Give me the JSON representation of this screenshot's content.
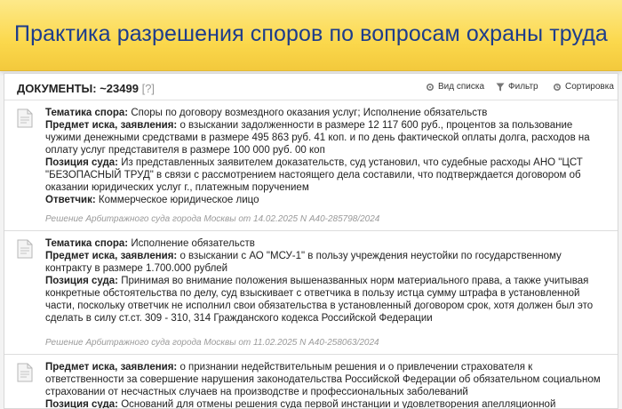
{
  "banner": {
    "title": "Практика разрешения споров по вопросам охраны труда"
  },
  "toolbar": {
    "count_label": "ДОКУМЕНТЫ: ~23499",
    "help_label": "[?]",
    "view_list_label": "Вид списка",
    "filter_label": "Фильтр",
    "sort_label": "Сортировка"
  },
  "labels": {
    "topic": "Тематика спора:",
    "claim": "Предмет иска, заявления:",
    "court": "Позиция суда:",
    "defendant": "Ответчик:"
  },
  "documents": [
    {
      "topic": "Споры по договору возмездного оказания услуг; Исполнение обязательств",
      "claim": "о взыскании задолженности в размере 12 117 600 руб., процентов за пользование чужими денежными средствами в размере 495 863 руб. 41 коп. и по день фактической оплаты долга, расходов на оплату услуг представителя в размере 100 000 руб. 00 коп",
      "court": "Из представленных заявителем доказательств, суд установил, что судебные расходы АНО \"ЦСТ \"БЕЗОПАСНЫЙ ТРУД\" в связи с рассмотрением настоящего дела составили, что подтверждается договором об оказании юридических услуг г., платежным поручением",
      "defendant": "Коммерческое юридическое лицо",
      "source": "Решение Арбитражного суда города Москвы от 14.02.2025 N А40-285798/2024"
    },
    {
      "topic": "Исполнение обязательств",
      "claim": "о взыскании с АО \"МСУ-1\" в пользу учреждения неустойки по государственному контракту в размере 1.700.000 рублей",
      "court": "Принимая во внимание положения вышеназванных норм материального права, а также учитывая конкретные обстоятельства по делу, суд взыскивает с ответчика в пользу истца сумму штрафа в установленной части, поскольку ответчик не исполнил свои обязательства в установленный договором срок, хотя должен был это сделать в силу ст.ст. 309 - 310, 314 Гражданского кодекса Российской Федерации",
      "source": "Решение Арбитражного суда города Москвы от 11.02.2025 N А40-258063/2024"
    },
    {
      "claim": "о признании недействительным решения и о привлечении страхователя к ответственности за совершение нарушения законодательства Российской Федерации об обязательном социальном страховании от несчастных случаев на производстве и профессиональных заболеваний",
      "court": "Оснований для отмены решения суда первой инстанции и удовлетворения апелляционной"
    }
  ]
}
